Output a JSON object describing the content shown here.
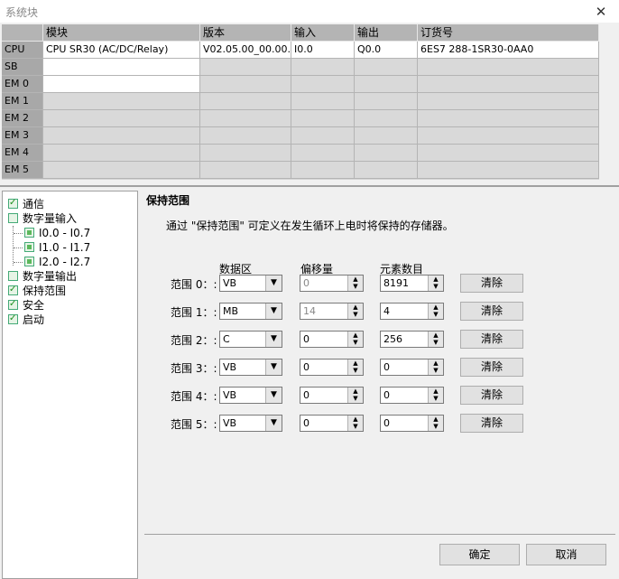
{
  "window": {
    "title": "系统块",
    "close_glyph": "✕"
  },
  "module_table": {
    "headers": [
      "",
      "模块",
      "版本",
      "输入",
      "输出",
      "订货号"
    ],
    "rows": [
      {
        "slot": "CPU",
        "module": "CPU SR30 (AC/DC/Relay)",
        "version": "V02.05.00_00.00...",
        "input": "I0.0",
        "output": "Q0.0",
        "order": "6ES7 288-1SR30-0AA0"
      },
      {
        "slot": "SB",
        "module": "",
        "version": "",
        "input": "",
        "output": "",
        "order": ""
      },
      {
        "slot": "EM 0",
        "module": "",
        "version": "",
        "input": "",
        "output": "",
        "order": ""
      },
      {
        "slot": "EM 1",
        "module": "",
        "version": "",
        "input": "",
        "output": "",
        "order": ""
      },
      {
        "slot": "EM 2",
        "module": "",
        "version": "",
        "input": "",
        "output": "",
        "order": ""
      },
      {
        "slot": "EM 3",
        "module": "",
        "version": "",
        "input": "",
        "output": "",
        "order": ""
      },
      {
        "slot": "EM 4",
        "module": "",
        "version": "",
        "input": "",
        "output": "",
        "order": ""
      },
      {
        "slot": "EM 5",
        "module": "",
        "version": "",
        "input": "",
        "output": "",
        "order": ""
      }
    ]
  },
  "tree": {
    "comm": "通信",
    "di": "数字量输入",
    "di_ch0": "I0.0 - I0.7",
    "di_ch1": "I1.0 - I1.7",
    "di_ch2": "I2.0 - I2.7",
    "dq": "数字量输出",
    "retentive": "保持范围",
    "security": "安全",
    "startup": "启动"
  },
  "panel": {
    "title": "保持范围",
    "description": "通过 \"保持范围\" 可定义在发生循环上电时将保持的存储器。",
    "col_area": "数据区",
    "col_offset": "偏移量",
    "col_count": "元素数目",
    "clear_label": "清除",
    "ranges": [
      {
        "label": "范围 0：:",
        "area": "VB",
        "offset": "0",
        "count": "8191"
      },
      {
        "label": "范围 1：:",
        "area": "MB",
        "offset": "14",
        "count": "4"
      },
      {
        "label": "范围 2：:",
        "area": "C",
        "offset": "0",
        "count": "256"
      },
      {
        "label": "范围 3：:",
        "area": "VB",
        "offset": "0",
        "count": "0"
      },
      {
        "label": "范围 4：:",
        "area": "VB",
        "offset": "0",
        "count": "0"
      },
      {
        "label": "范围 5：:",
        "area": "VB",
        "offset": "0",
        "count": "0"
      }
    ]
  },
  "buttons": {
    "ok": "确定",
    "cancel": "取消"
  }
}
